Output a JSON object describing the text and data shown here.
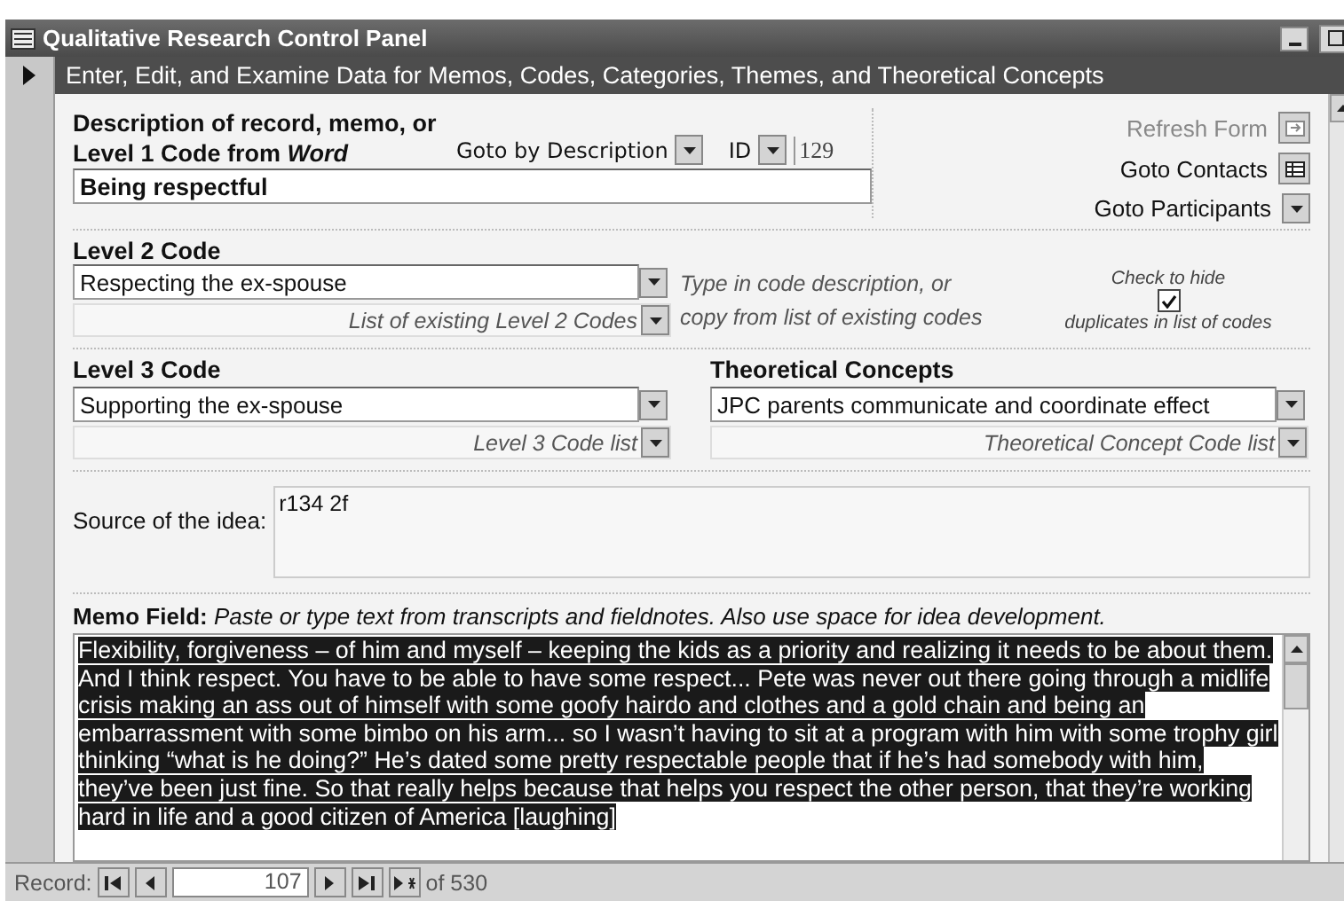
{
  "window": {
    "title": "Qualitative Research Control Panel"
  },
  "header": "Enter, Edit, and Examine Data for Memos, Codes, Categories, Themes, and Theoretical Concepts",
  "description": {
    "label_lines": [
      "Description of record, memo, or",
      "Level 1 Code from *Word*"
    ],
    "value": "Being respectful"
  },
  "goto_description": {
    "label": "Goto by Description"
  },
  "id": {
    "label": "ID",
    "value": "129"
  },
  "nav_buttons": [
    {
      "label": "Refresh Form",
      "disabled": true,
      "kind": "refresh"
    },
    {
      "label": "Goto Contacts",
      "disabled": false,
      "kind": "grid"
    },
    {
      "label": "Goto Participants",
      "disabled": false,
      "kind": "dropdown"
    }
  ],
  "level2": {
    "label": "Level 2 Code",
    "value": "Respecting the ex-spouse",
    "list_label": "List of existing Level 2 Codes",
    "hint_lines": [
      "Type in code description, or",
      "copy from list of existing codes"
    ]
  },
  "hide_duplicates": {
    "label_top": "Check to hide",
    "label_bottom": "duplicates in list of codes",
    "checked": true
  },
  "level3": {
    "label": "Level 3 Code",
    "value": "Supporting the ex-spouse",
    "list_label": "Level 3 Code list"
  },
  "theoretical_concepts": {
    "label": "Theoretical Concepts",
    "value": "JPC parents communicate and coordinate effect",
    "list_label": "Theoretical Concept Code list"
  },
  "source": {
    "label": "Source of the idea:",
    "value": "r134 2f"
  },
  "memo": {
    "label": "Memo Field:",
    "hint": "Paste or type text from transcripts and fieldnotes. Also use space for idea development.",
    "selected": true,
    "value": "Flexibility, forgiveness – of him and myself – keeping the kids as a priority and realizing it needs to be about them.  And I think respect.  You have to be able to have some respect... Pete was never out there going through a midlife crisis making an ass out of himself with some goofy hairdo and clothes and a gold chain and being an embarrassment with some bimbo on his arm... so I wasn’t having to sit at a program with him with some trophy girl thinking “what is he doing?”  He’s dated some pretty respectable people that if he’s had somebody with him, they’ve been just fine.  So that really helps because that helps you respect the other person, that they’re working hard in life and a good citizen of America [laughing]"
  },
  "record_nav": {
    "label": "Record:",
    "value": "107",
    "total": "of 530"
  }
}
